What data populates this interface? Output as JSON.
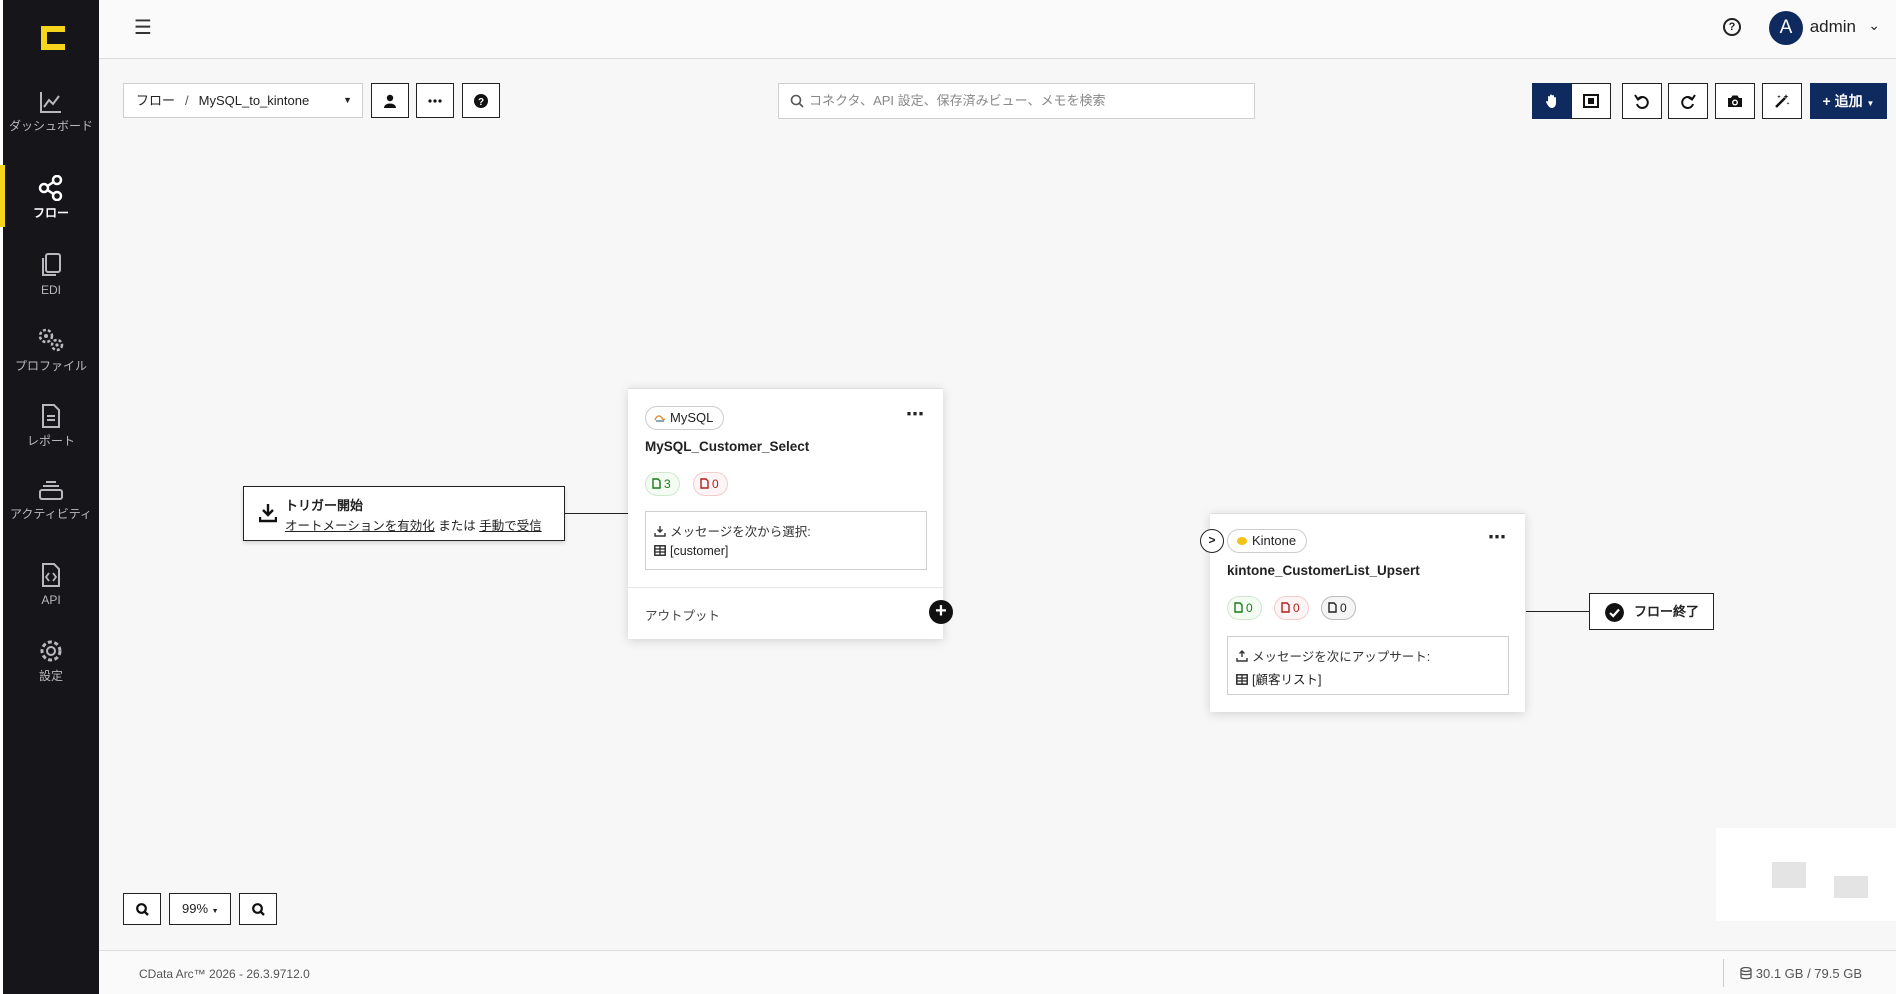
{
  "sidebar": {
    "items": [
      {
        "label": "ダッシュボード",
        "icon": "chart-line-icon"
      },
      {
        "label": "フロー",
        "icon": "flow-share-icon",
        "active": true
      },
      {
        "label": "EDI",
        "icon": "files-icon"
      },
      {
        "label": "プロファイル",
        "icon": "gears-icon"
      },
      {
        "label": "レポート",
        "icon": "document-icon"
      },
      {
        "label": "アクティビティ",
        "icon": "stack-icon"
      },
      {
        "label": "API",
        "icon": "code-file-icon"
      },
      {
        "label": "設定",
        "icon": "settings-icon"
      }
    ]
  },
  "topbar": {
    "avatar_letter": "A",
    "user": "admin"
  },
  "toolbar": {
    "breadcrumb_root": "フロー",
    "breadcrumb_sep": "/",
    "flow_name": "MySQL_to_kintone",
    "search_placeholder": "コネクタ、API 設定、保存済みビュー、メモを検索",
    "add_label": "+ 追加"
  },
  "trigger": {
    "title": "トリガー開始",
    "link1": "オートメーションを有効化",
    "or": "または",
    "link2": "手動で受信"
  },
  "mysql_card": {
    "connector": "MySQL",
    "title": "MySQL_Customer_Select",
    "success_count": "3",
    "error_count": "0",
    "msg_label": "メッセージを次から選択:",
    "table": "[customer]",
    "output_label": "アウトプット"
  },
  "kintone_card": {
    "connector": "Kintone",
    "title": "kintone_CustomerList_Upsert",
    "success_count": "0",
    "error_count": "0",
    "pending_count": "0",
    "msg_label": "メッセージを次にアップサート:",
    "table": "[顧客リスト]"
  },
  "flow_end": {
    "label": "フロー終了"
  },
  "zoom": {
    "level": "99%"
  },
  "footer": {
    "version": "CData Arc™ 2026 - 26.3.9712.0",
    "disk": "30.1 GB / 79.5 GB"
  },
  "colors": {
    "sidebar_bg": "#16161a",
    "accent_yellow": "#f7d51d",
    "primary_navy": "#0e2a5e"
  }
}
